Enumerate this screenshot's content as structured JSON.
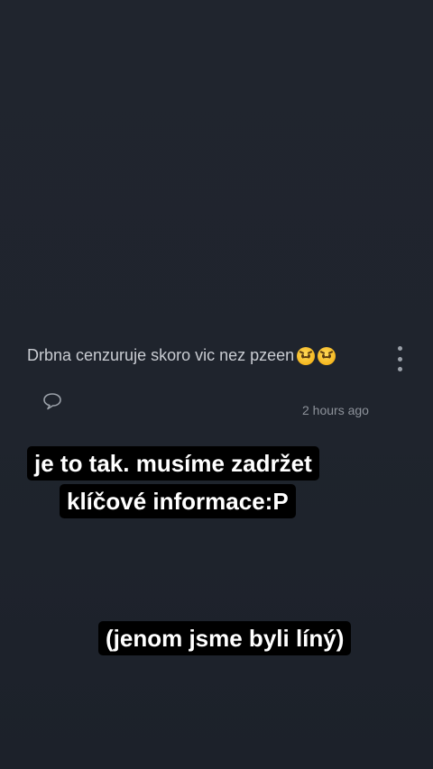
{
  "post": {
    "text": "Drbna cenzuruje skoro vic nez pzeen",
    "emojis": [
      "angry-face",
      "angry-face"
    ],
    "timestamp": "2 hours ago",
    "more_icon": "more-vertical-icon",
    "comment_icon": "speech-bubble-icon"
  },
  "captions": {
    "line1": "je to tak. musíme zadržet",
    "line2": "klíčové informace:P",
    "line3": "(jenom jsme byli líný)"
  },
  "colors": {
    "background": "#1f242d",
    "text": "#c9ccd2",
    "muted": "#8d929a",
    "caption_bg": "#000000",
    "caption_text": "#ffffff"
  }
}
